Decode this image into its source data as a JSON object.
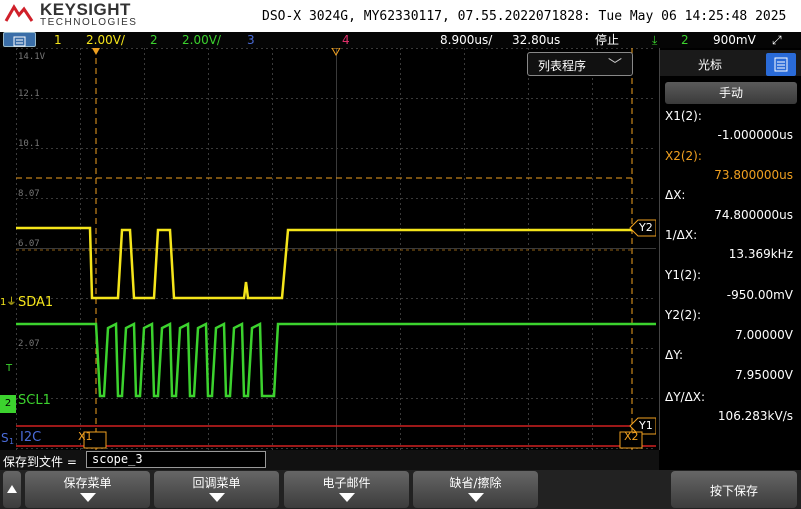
{
  "header": {
    "brand": "KEYSIGHT",
    "subbrand": "TECHNOLOGIES",
    "instrument_line": "DSO-X 3024G, MY62330117, 07.55.2022071828: Tue May 06 14:25:48 2025"
  },
  "status": {
    "ch1_num": "1",
    "ch1_scale": "2.00V/",
    "ch2_num": "2",
    "ch2_scale": "2.00V/",
    "ch3_num": "3",
    "ch4_num": "4",
    "timebase": "8.900us/",
    "delay": "32.80us",
    "run_state": "停止",
    "trigger_icon": "trigger-edge-icon",
    "trigger_source": "2",
    "trigger_level": "900mV",
    "mode_icon": "expand-arrows-icon"
  },
  "display": {
    "y_ticks": [
      "14.1V",
      "12.1",
      "10.1",
      "8.07",
      "6.07",
      "2.07"
    ],
    "ch1_label": "SDA1",
    "ch2_label": "SCL1",
    "ch1_marker": "1",
    "ch2_marker": "2",
    "trig_marker": "T",
    "serial_marker_s": "S",
    "serial_marker_1": "1",
    "serial_label": "I2C",
    "x1_label": "X1",
    "x2_label": "X2",
    "y1_label": "Y1",
    "y2_label": "Y2",
    "list_menu_label": "列表程序",
    "colors": {
      "ch1": "#f5e51b",
      "ch2": "#3cd22e",
      "ch3": "#4a6bd8",
      "ch4": "#e0306a",
      "cursor": "#f0a020",
      "serial": "#d02020"
    }
  },
  "cursor_panel": {
    "title": "光标",
    "mode_button": "手动",
    "x1_label": "X1(2):",
    "x1_value": "-1.000000us",
    "x2_label": "X2(2):",
    "x2_value": "73.800000us",
    "dx_label": "ΔX:",
    "dx_value": "74.800000us",
    "inv_dx_label": "1/ΔX:",
    "inv_dx_value": "13.369kHz",
    "y1_label": "Y1(2):",
    "y1_value": "-950.00mV",
    "y2_label": "Y2(2):",
    "y2_value": "7.00000V",
    "dy_label": "ΔY:",
    "dy_value": "7.95000V",
    "dydx_label": "ΔY/ΔX:",
    "dydx_value": "106.283kV/s"
  },
  "savebar": {
    "label": "保存到文件 =",
    "filename": "scope_3"
  },
  "softkeys": {
    "k1": "保存菜单",
    "k2": "回调菜单",
    "k3": "电子邮件",
    "k4": "缺省/擦除",
    "k5": "按下保存"
  }
}
